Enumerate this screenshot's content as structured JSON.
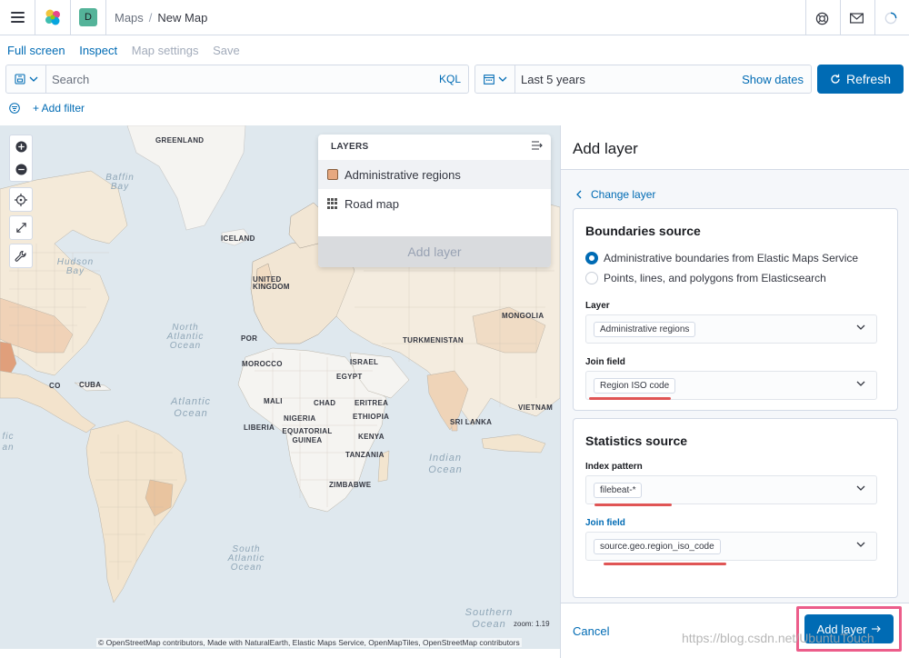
{
  "header": {
    "space_initial": "D",
    "breadcrumbs": [
      "Maps",
      "New Map"
    ]
  },
  "topnav": {
    "full_screen": "Full screen",
    "inspect": "Inspect",
    "map_settings": "Map settings",
    "save": "Save"
  },
  "query": {
    "placeholder": "Search",
    "language": "KQL"
  },
  "datepicker": {
    "range": "Last 5 years",
    "show_dates": "Show dates"
  },
  "refresh_label": "Refresh",
  "add_filter_label": "+ Add filter",
  "map": {
    "labels": {
      "greenland": "GREENLAND",
      "iceland": "ICELAND",
      "united_kingdom": "UNITED KINGDOM",
      "portugal": "POR",
      "morocco": "MOROCCO",
      "egypt": "EGYPT",
      "israel": "ISRAEL",
      "turkmenistan": "TURKMENISTAN",
      "mongolia": "MONGOLIA",
      "mali": "MALI",
      "chad": "CHAD",
      "eritrea": "ERITREA",
      "liberia": "LIBERIA",
      "nigeria": "NIGERIA",
      "ethiopia": "ETHIOPIA",
      "equatorial_guinea": "EQUATORIAL GUINEA",
      "kenya": "KENYA",
      "tanzania": "TANZANIA",
      "zimbabwe": "ZIMBABWE",
      "cuba": "CUBA",
      "mexico": "CO",
      "sri_lanka": "SRI LANKA",
      "vietnam": "VIETNAM",
      "baffin_bay": "Baffin Bay",
      "hudson_bay": "Hudson Bay",
      "north_atlantic": "North Atlantic Ocean",
      "atlantic": "Atlantic Ocean",
      "indian": "Indian Ocean",
      "south_atlantic": "South Atlantic Ocean",
      "southern": "Southern Ocean",
      "pacific_fragment": "fic an"
    },
    "zoom_label": "zoom: 1.19",
    "attribution": "© OpenStreetMap contributors, Made with NaturalEarth, Elastic Maps Service, OpenMapTiles, OpenStreetMap contributors"
  },
  "layers_panel": {
    "heading": "LAYERS",
    "items": [
      {
        "label": "Administrative regions",
        "color": "#e7a87f"
      },
      {
        "label": "Road map"
      }
    ],
    "add_layer": "Add layer"
  },
  "add_layer_panel": {
    "title": "Add layer",
    "change_layer": "Change layer",
    "boundaries": {
      "title": "Boundaries source",
      "options": [
        {
          "label": "Administrative boundaries from Elastic Maps Service",
          "selected": true
        },
        {
          "label": "Points, lines, and polygons from Elasticsearch",
          "selected": false
        }
      ],
      "layer_label": "Layer",
      "layer_value": "Administrative regions",
      "join_label": "Join field",
      "join_value": "Region ISO code"
    },
    "statistics": {
      "title": "Statistics source",
      "index_label": "Index pattern",
      "index_value": "filebeat-*",
      "join_label": "Join field",
      "join_value": "source.geo.region_iso_code"
    },
    "cancel": "Cancel",
    "add_layer": "Add layer"
  },
  "watermark": "https://blog.csdn.net/UbuntuTouch",
  "colors": {
    "accent": "#006bb4",
    "highlight": "#ec5d8a",
    "annotation": "#e05555"
  }
}
